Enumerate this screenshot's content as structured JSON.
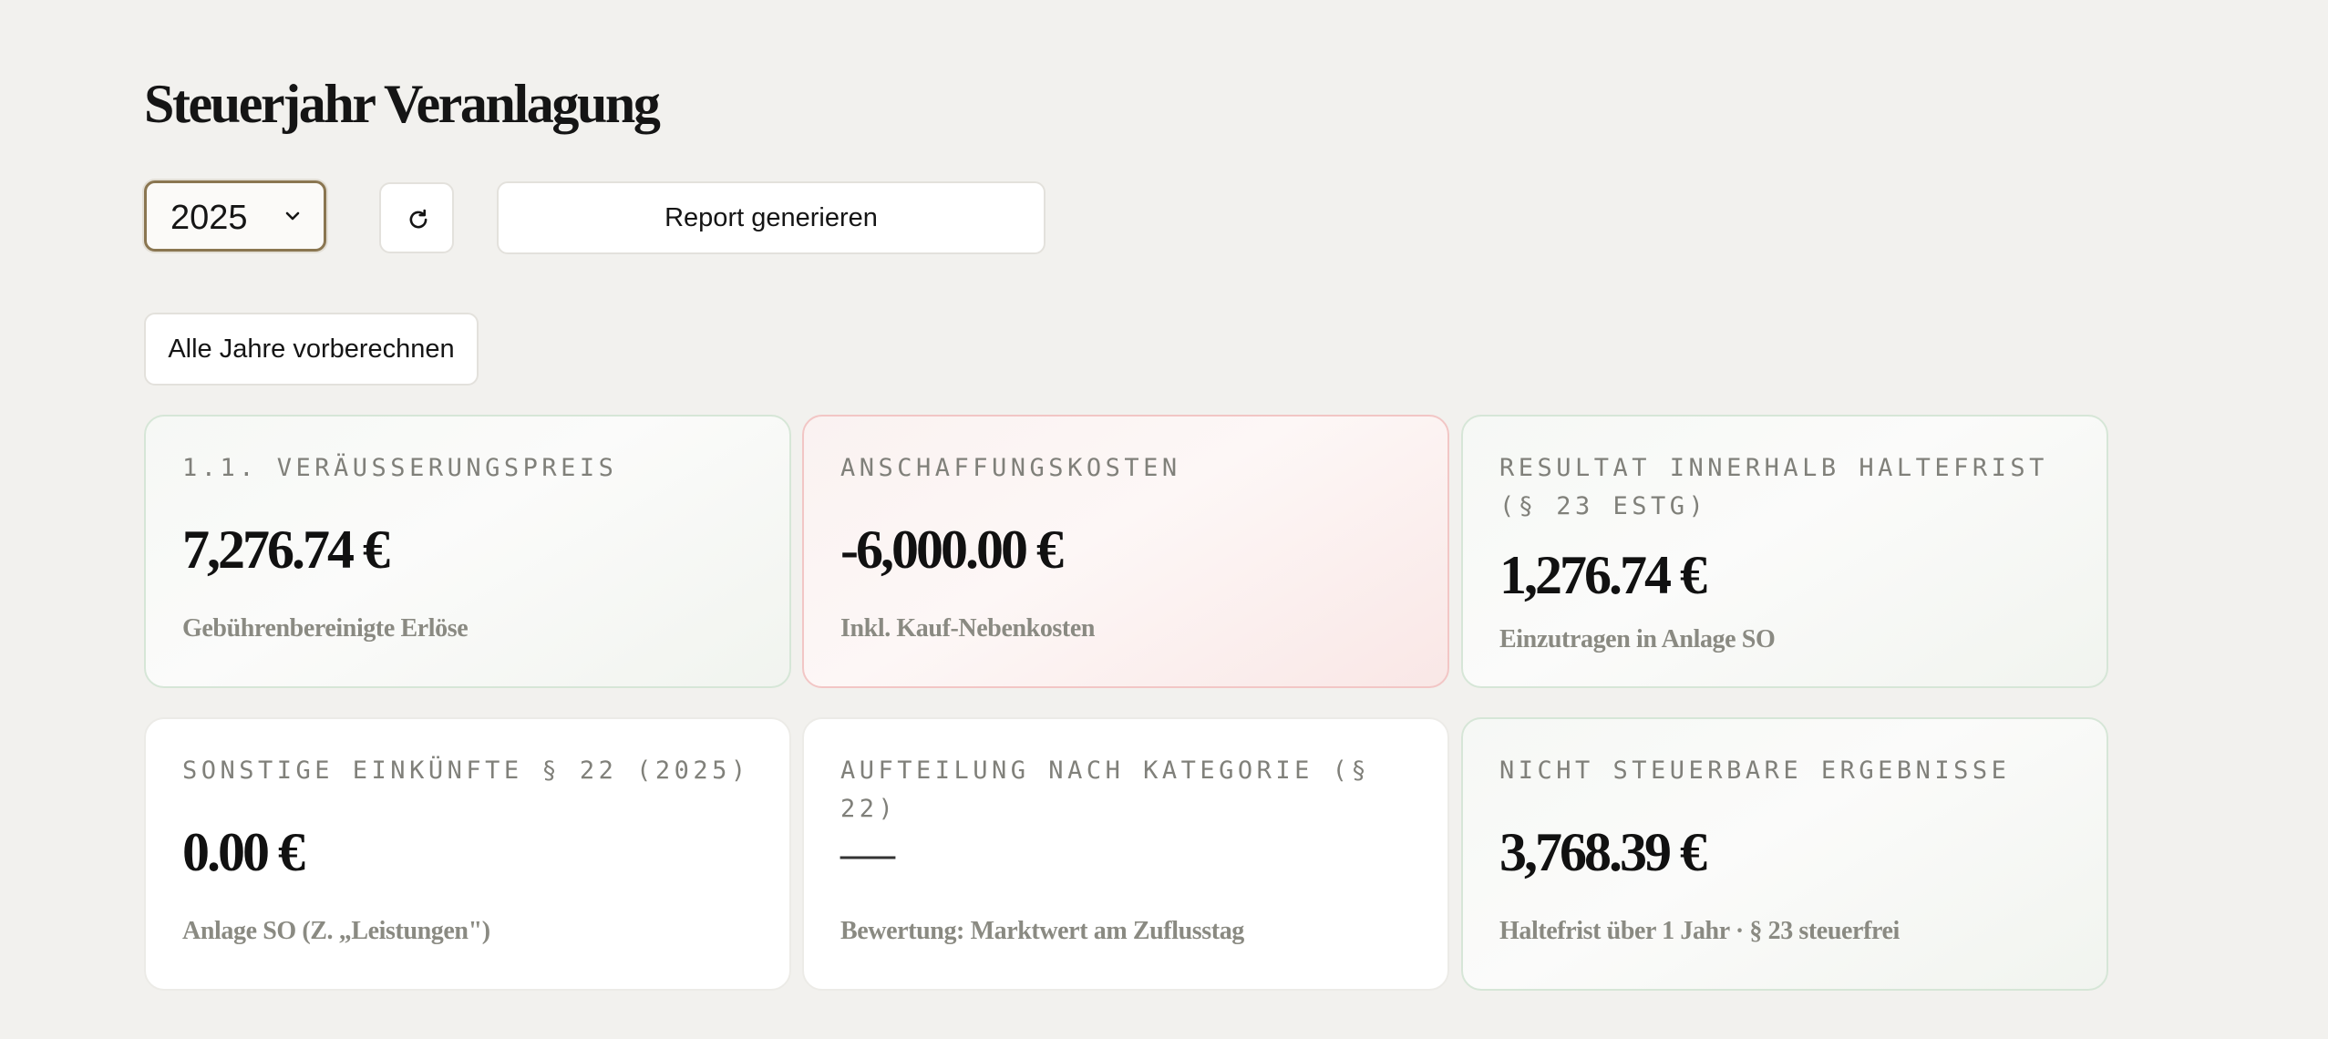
{
  "header": {
    "title": "Steuerjahr Veranlagung"
  },
  "controls": {
    "year_select": {
      "selected": "2025"
    },
    "refresh_icon": "refresh-icon",
    "report_label": "Report generieren",
    "precompute_label": "Alle Jahre vorberechnen"
  },
  "cards": [
    {
      "label": "1.1. Veräusserungspreis",
      "value": "7,276.74 €",
      "sub": "Gebührenbereinigte Erlöse",
      "tone": "green"
    },
    {
      "label": "Anschaffungskosten",
      "value": "-6,000.00 €",
      "sub": "Inkl. Kauf-Nebenkosten",
      "tone": "red"
    },
    {
      "label": "Resultat innerhalb Haltefrist (§ 23 EStG)",
      "value": "1,276.74 €",
      "sub": "Einzutragen in Anlage SO",
      "tone": "green"
    },
    {
      "label": "Sonstige Einkünfte § 22 (2025)",
      "value": "0.00 €",
      "sub": "Anlage SO (Z. „Leistungen\")",
      "tone": "white"
    },
    {
      "label": "Aufteilung nach Kategorie (§ 22)",
      "value": "—",
      "sub": "Bewertung: Marktwert am Zuflusstag",
      "tone": "white"
    },
    {
      "label": "Nicht steuerbare Ergebnisse",
      "value": "3,768.39 €",
      "sub": "Haltefrist über 1 Jahr · § 23 steuerfrei",
      "tone": "green"
    }
  ],
  "colors": {
    "background": "#f2f1ee",
    "accent_border": "#8a7651",
    "positive_tint": "#f1f4ef",
    "negative_tint": "#f9e7e6"
  }
}
